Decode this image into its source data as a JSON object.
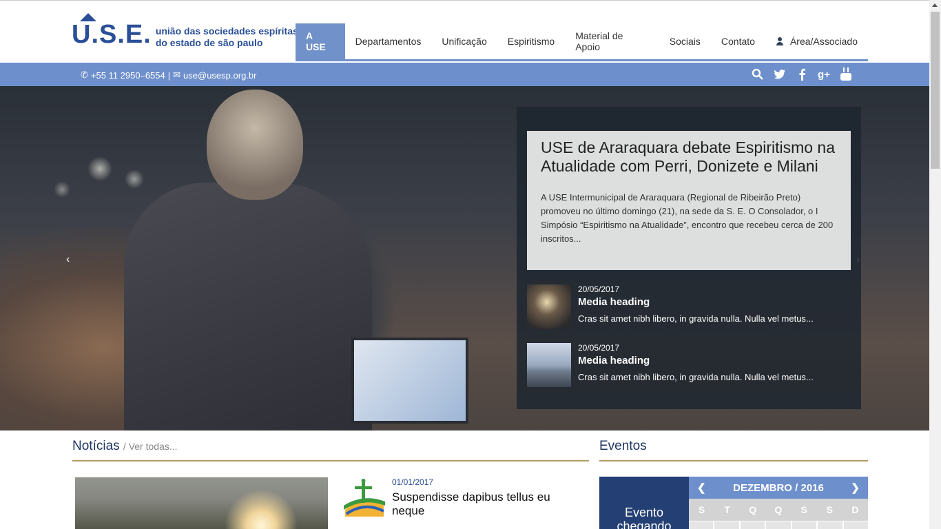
{
  "logo": {
    "mark": "U.S.E.",
    "line1": "união das sociedades espíritas",
    "line2": "do estado de são paulo"
  },
  "nav": {
    "items": [
      {
        "label": "A USE"
      },
      {
        "label": "Departamentos"
      },
      {
        "label": "Unificação"
      },
      {
        "label": "Espiritismo"
      },
      {
        "label": "Material de Apoio"
      },
      {
        "label": "Sociais"
      },
      {
        "label": "Contato"
      },
      {
        "label": "Área/Associado"
      }
    ]
  },
  "contact": {
    "phone": "+55 11 2950–6554",
    "separator": "|",
    "email": "use@usesp.org.br"
  },
  "social_icons": [
    "search-icon",
    "twitter-icon",
    "facebook-icon",
    "google-plus-icon",
    "youtube-icon"
  ],
  "hero": {
    "feature_title": "USE de Araraquara debate Espiritismo na Atualidade com Perri, Donizete e Milani",
    "feature_text": "A USE Intermunicipal de Araraquara (Regional de Ribeirão Preto) promoveu no último domingo (21), na sede da S. E. O Consolador, o I Simpósio “Espiritismo na Atualidade”, encontro que recebeu cerca de 200 inscritos...",
    "media": [
      {
        "date": "20/05/2017",
        "heading": "Media heading",
        "text": "Cras sit amet nibh libero, in gravida nulla. Nulla vel metus..."
      },
      {
        "date": "20/05/2017",
        "heading": "Media heading",
        "text": "Cras sit amet nibh libero, in gravida nulla. Nulla vel metus..."
      }
    ]
  },
  "news": {
    "title": "Notícias",
    "see_all": "/ Ver todas...",
    "item": {
      "date": "01/01/2017",
      "headline": "Suspendisse dapibus tellus eu neque"
    }
  },
  "events": {
    "title": "Eventos",
    "box_label": "Evento chegando",
    "calendar_month": "DEZEMBRO / 2016",
    "weekdays": [
      "S",
      "T",
      "Q",
      "Q",
      "S",
      "S",
      "D"
    ]
  },
  "colors": {
    "accent": "#6d8fcc",
    "brand": "#2a4f98",
    "rule": "#b49b62",
    "dark": "#243f74"
  }
}
